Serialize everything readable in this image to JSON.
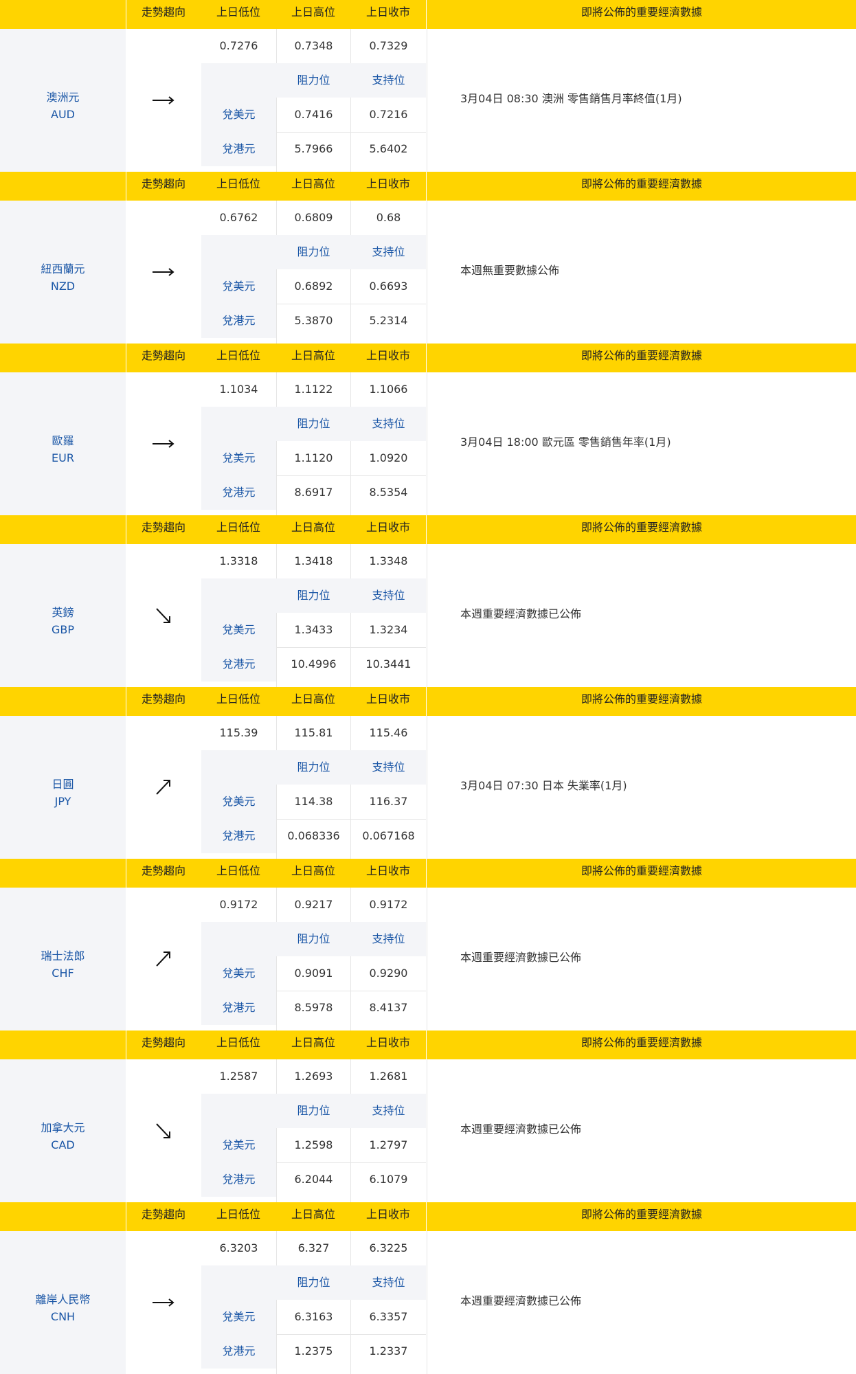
{
  "header": {
    "trend": "走勢趨向",
    "low": "上日低位",
    "high": "上日高位",
    "close": "上日收市",
    "news": "即將公佈的重要經濟數據"
  },
  "labels": {
    "resistance": "阻力位",
    "support": "支持位",
    "vs_usd": "兌美元",
    "vs_hkd": "兌港元"
  },
  "currencies": [
    {
      "name": "澳洲元",
      "code": "AUD",
      "trend_icon": "arrow-right-icon",
      "low": "0.7276",
      "high": "0.7348",
      "close": "0.7329",
      "usd_resistance": "0.7416",
      "usd_support": "0.7216",
      "hkd_resistance": "5.7966",
      "hkd_support": "5.6402",
      "news": "3月04日 08:30  澳洲 零售銷售月率終值(1月)"
    },
    {
      "name": "紐西蘭元",
      "code": "NZD",
      "trend_icon": "arrow-right-icon",
      "low": "0.6762",
      "high": "0.6809",
      "close": "0.68",
      "usd_resistance": "0.6892",
      "usd_support": "0.6693",
      "hkd_resistance": "5.3870",
      "hkd_support": "5.2314",
      "news": "本週無重要數據公佈"
    },
    {
      "name": "歐羅",
      "code": "EUR",
      "trend_icon": "arrow-right-icon",
      "low": "1.1034",
      "high": "1.1122",
      "close": "1.1066",
      "usd_resistance": "1.1120",
      "usd_support": "1.0920",
      "hkd_resistance": "8.6917",
      "hkd_support": "8.5354",
      "news": "3月04日 18:00 歐元區 零售銷售年率(1月)"
    },
    {
      "name": "英鎊",
      "code": "GBP",
      "trend_icon": "arrow-down-right-icon",
      "low": "1.3318",
      "high": "1.3418",
      "close": "1.3348",
      "usd_resistance": "1.3433",
      "usd_support": "1.3234",
      "hkd_resistance": "10.4996",
      "hkd_support": "10.3441",
      "news": "本週重要經濟數據已公佈"
    },
    {
      "name": "日圓",
      "code": "JPY",
      "trend_icon": "arrow-up-right-icon",
      "low": "115.39",
      "high": "115.81",
      "close": "115.46",
      "usd_resistance": "114.38",
      "usd_support": "116.37",
      "hkd_resistance": "0.068336",
      "hkd_support": "0.067168",
      "news": "3月04日 07:30  日本 失業率(1月)"
    },
    {
      "name": "瑞士法郎",
      "code": "CHF",
      "trend_icon": "arrow-up-right-icon",
      "low": "0.9172",
      "high": "0.9217",
      "close": "0.9172",
      "usd_resistance": "0.9091",
      "usd_support": "0.9290",
      "hkd_resistance": "8.5978",
      "hkd_support": "8.4137",
      "news": "本週重要經濟數據已公佈"
    },
    {
      "name": "加拿大元",
      "code": "CAD",
      "trend_icon": "arrow-down-right-icon",
      "low": "1.2587",
      "high": "1.2693",
      "close": "1.2681",
      "usd_resistance": "1.2598",
      "usd_support": "1.2797",
      "hkd_resistance": "6.2044",
      "hkd_support": "6.1079",
      "news": "本週重要經濟數據已公佈"
    },
    {
      "name": "離岸人民幣",
      "code": "CNH",
      "trend_icon": "arrow-right-icon",
      "low": "6.3203",
      "high": "6.327",
      "close": "6.3225",
      "usd_resistance": "6.3163",
      "usd_support": "6.3357",
      "hkd_resistance": "1.2375",
      "hkd_support": "1.2337",
      "news": "本週重要經濟數據已公佈"
    }
  ]
}
